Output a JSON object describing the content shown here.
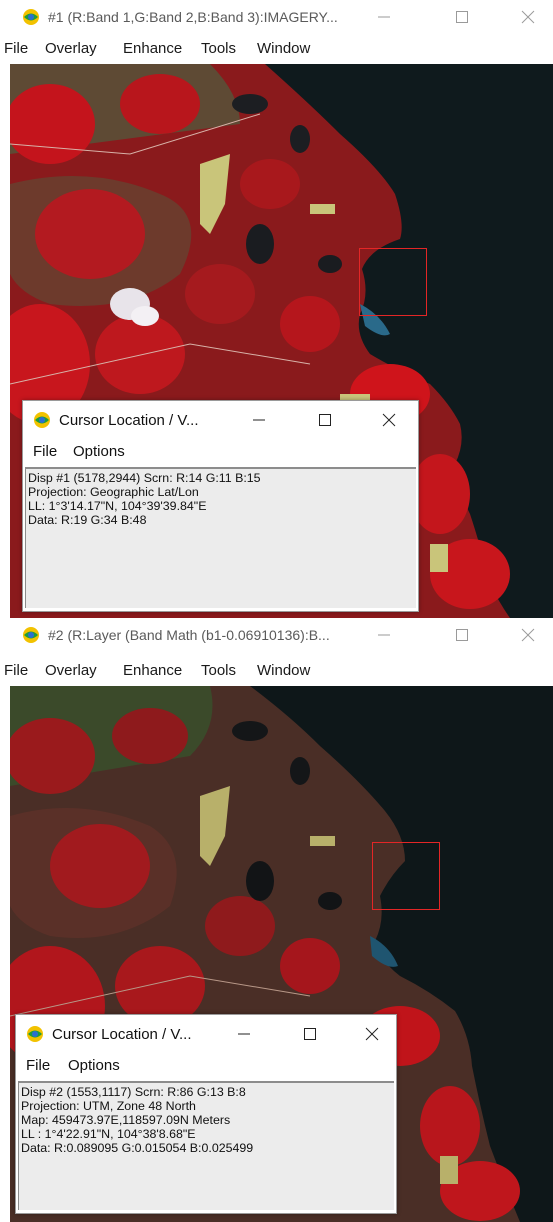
{
  "window1": {
    "title": "#1 (R:Band 1,G:Band 2,B:Band 3):IMAGERY...",
    "menu": [
      "File",
      "Overlay",
      "Enhance",
      "Tools",
      "Window"
    ],
    "cursor_dialog": {
      "title": "Cursor Location / V...",
      "menu": [
        "File",
        "Options"
      ],
      "lines": [
        "Disp #1 (5178,2944) Scrn: R:14 G:11 B:15",
        "Projection: Geographic Lat/Lon",
        "LL: 1°3'14.17\"N, 104°39'39.84\"E",
        "Data: R:19 G:34 B:48"
      ]
    }
  },
  "window2": {
    "title": "#2 (R:Layer (Band Math (b1-0.06910136):B...",
    "menu": [
      "File",
      "Overlay",
      "Enhance",
      "Tools",
      "Window"
    ],
    "cursor_dialog": {
      "title": "Cursor Location / V...",
      "menu": [
        "File",
        "Options"
      ],
      "lines": [
        "Disp #2 (1553,1117) Scrn: R:86 G:13 B:8",
        "Projection: UTM, Zone 48 North",
        "Map: 459473.97E,118597.09N Meters",
        "LL : 1°4'22.91\"N, 104°38'8.68\"E",
        "Data: R:0.089095 G:0.015054 B:0.025499"
      ]
    }
  },
  "icons": {
    "app": "envi-globe-icon",
    "minimize": "minimize-icon",
    "maximize": "maximize-icon",
    "close": "close-icon"
  },
  "colors": {
    "vegetation_red": "#c4141c",
    "water_dark": "#0f1a1d",
    "zoom_box": "#e32626"
  }
}
